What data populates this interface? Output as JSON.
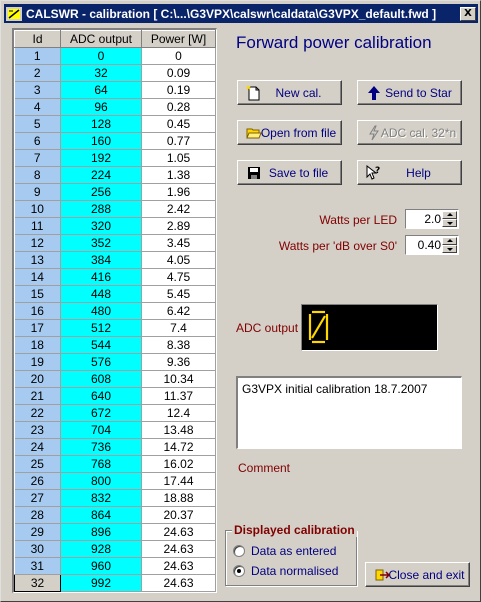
{
  "window": {
    "title": "CALSWR - calibration  [ C:\\...\\G3VPX\\calswr\\caldata\\G3VPX_default.fwd ]",
    "close_label": "X"
  },
  "table": {
    "columns": [
      "Id",
      "ADC output",
      "Power [W]"
    ],
    "selected_row": 32,
    "rows": [
      [
        "1",
        "0",
        "0"
      ],
      [
        "2",
        "32",
        "0.09"
      ],
      [
        "3",
        "64",
        "0.19"
      ],
      [
        "4",
        "96",
        "0.28"
      ],
      [
        "5",
        "128",
        "0.45"
      ],
      [
        "6",
        "160",
        "0.77"
      ],
      [
        "7",
        "192",
        "1.05"
      ],
      [
        "8",
        "224",
        "1.38"
      ],
      [
        "9",
        "256",
        "1.96"
      ],
      [
        "10",
        "288",
        "2.42"
      ],
      [
        "11",
        "320",
        "2.89"
      ],
      [
        "12",
        "352",
        "3.45"
      ],
      [
        "13",
        "384",
        "4.05"
      ],
      [
        "14",
        "416",
        "4.75"
      ],
      [
        "15",
        "448",
        "5.45"
      ],
      [
        "16",
        "480",
        "6.42"
      ],
      [
        "17",
        "512",
        "7.4"
      ],
      [
        "18",
        "544",
        "8.38"
      ],
      [
        "19",
        "576",
        "9.36"
      ],
      [
        "20",
        "608",
        "10.34"
      ],
      [
        "21",
        "640",
        "11.37"
      ],
      [
        "22",
        "672",
        "12.4"
      ],
      [
        "23",
        "704",
        "13.48"
      ],
      [
        "24",
        "736",
        "14.72"
      ],
      [
        "25",
        "768",
        "16.02"
      ],
      [
        "26",
        "800",
        "17.44"
      ],
      [
        "27",
        "832",
        "18.88"
      ],
      [
        "28",
        "864",
        "20.37"
      ],
      [
        "29",
        "896",
        "24.63"
      ],
      [
        "30",
        "928",
        "24.63"
      ],
      [
        "31",
        "960",
        "24.63"
      ],
      [
        "32",
        "992",
        "24.63"
      ]
    ]
  },
  "heading": "Forward power calibration",
  "buttons": {
    "new_cal": "New cal.",
    "send_to_star": "Send to Star",
    "open_from_file": "Open from file",
    "adc_cal": "ADC cal. 32*n",
    "save_to_file": "Save to file",
    "help": "Help",
    "close_and_exit": "Close and exit"
  },
  "settings": {
    "watts_per_led_label": "Watts per LED",
    "watts_per_led_value": "2.0",
    "watts_per_db_label": "Watts per 'dB over S0'",
    "watts_per_db_value": "0.40"
  },
  "adc": {
    "label": "ADC output",
    "display_color": "#ffd700"
  },
  "comment": {
    "text": "G3VPX initial calibration 18.7.2007",
    "label": "Comment"
  },
  "display_group": {
    "title": "Displayed calibration",
    "options": [
      "Data as entered",
      "Data normalised"
    ],
    "selected": "Data normalised"
  }
}
